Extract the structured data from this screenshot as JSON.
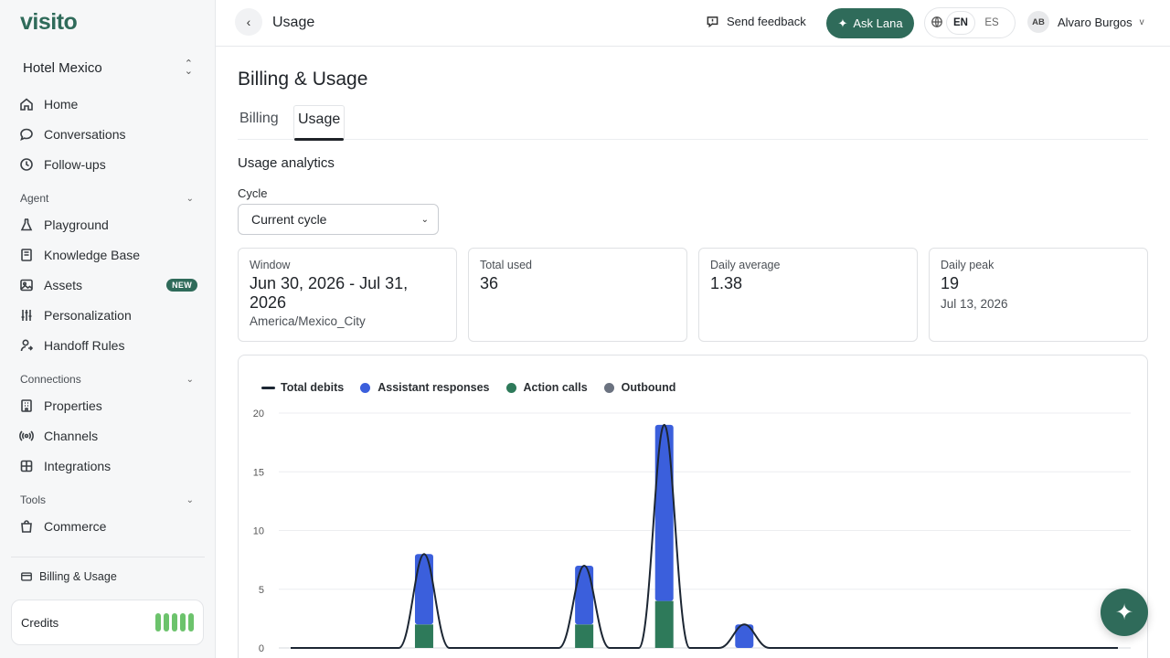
{
  "brand": {
    "logo": "visito"
  },
  "sidebar": {
    "hotel": "Hotel Mexico",
    "main_items": [
      {
        "label": "Home",
        "icon": "home-icon"
      },
      {
        "label": "Conversations",
        "icon": "chat-icon"
      },
      {
        "label": "Follow-ups",
        "icon": "clock-icon"
      }
    ],
    "agent": {
      "title": "Agent",
      "items": [
        {
          "label": "Playground",
          "icon": "flask-icon"
        },
        {
          "label": "Knowledge Base",
          "icon": "book-icon"
        },
        {
          "label": "Assets",
          "icon": "image-icon",
          "badge": "NEW"
        },
        {
          "label": "Personalization",
          "icon": "sliders-icon"
        },
        {
          "label": "Handoff Rules",
          "icon": "user-handoff-icon"
        }
      ]
    },
    "connections": {
      "title": "Connections",
      "items": [
        {
          "label": "Properties",
          "icon": "building-icon"
        },
        {
          "label": "Channels",
          "icon": "broadcast-icon"
        },
        {
          "label": "Integrations",
          "icon": "puzzle-icon"
        }
      ]
    },
    "tools": {
      "title": "Tools",
      "items": [
        {
          "label": "Commerce",
          "icon": "shopping-bag-icon"
        }
      ]
    },
    "billing_link": "Billing & Usage",
    "credits_label": "Credits"
  },
  "topbar": {
    "title": "Usage",
    "feedback": "Send feedback",
    "ask_lana": "Ask Lana",
    "lang_en": "EN",
    "lang_es": "ES",
    "user_initials": "AB",
    "user_name": "Alvaro Burgos",
    "user_caret": "v"
  },
  "main": {
    "page_title": "Billing & Usage",
    "tabs": [
      "Billing",
      "Usage"
    ],
    "section_title": "Usage analytics",
    "cycle_label": "Cycle",
    "cycle_value": "Current cycle",
    "cards": {
      "window": {
        "label": "Window",
        "value": "Jun 30, 2026 - Jul 31, 2026",
        "sub": "America/Mexico_City"
      },
      "total": {
        "label": "Total used",
        "value": "36"
      },
      "average": {
        "label": "Daily average",
        "value": "1.38"
      },
      "peak": {
        "label": "Daily peak",
        "value": "19",
        "sub": "Jul 13, 2026"
      }
    }
  },
  "colors": {
    "brand": "#2f6b5a",
    "assistant": "#3b5fdc",
    "action": "#2e7a5a",
    "outbound": "#6b7280",
    "total_line": "#1c2633"
  },
  "chart_data": {
    "type": "bar",
    "legend": [
      "Total debits",
      "Assistant responses",
      "Action calls",
      "Outbound"
    ],
    "yticks": [
      0,
      5,
      10,
      15,
      20
    ],
    "ylim": [
      0,
      20
    ],
    "days_count": 32,
    "series": [
      {
        "name": "Assistant responses",
        "points": [
          [
            5,
            6
          ],
          [
            11,
            5
          ],
          [
            14,
            15
          ],
          [
            17,
            2
          ]
        ]
      },
      {
        "name": "Action calls",
        "points": [
          [
            5,
            2
          ],
          [
            11,
            2
          ],
          [
            14,
            4
          ],
          [
            17,
            0
          ]
        ]
      },
      {
        "name": "Outbound",
        "points": []
      }
    ],
    "total_debits": [
      [
        5,
        8
      ],
      [
        11,
        7
      ],
      [
        14,
        19
      ],
      [
        17,
        2
      ]
    ]
  }
}
